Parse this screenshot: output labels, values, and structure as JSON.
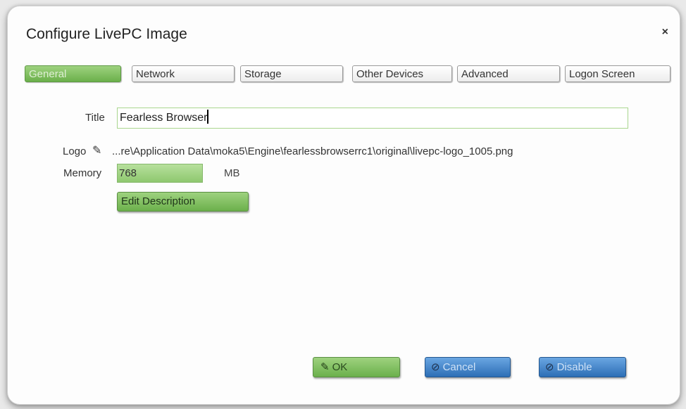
{
  "dialog": {
    "title": "Configure LivePC Image",
    "close_glyph": "×"
  },
  "tabs": [
    {
      "label": "General",
      "active": true
    },
    {
      "label": "Network",
      "active": false
    },
    {
      "label": "Storage",
      "active": false
    },
    {
      "label": "Other Devices",
      "active": false
    },
    {
      "label": "Advanced",
      "active": false
    },
    {
      "label": "Logon Screen",
      "active": false
    }
  ],
  "form": {
    "title_label": "Title",
    "title_value": "Fearless Browser",
    "logo_label": "Logo",
    "logo_icon": "pencil-icon",
    "logo_path": "...re\\Application Data\\moka5\\Engine\\fearlessbrowserrc1\\original\\livepc-logo_1005.png",
    "memory_label": "Memory",
    "memory_value": "768",
    "memory_unit": "MB",
    "edit_description_label": "Edit Description"
  },
  "buttons": {
    "ok_label": "OK",
    "cancel_label": "Cancel",
    "disable_label": "Disable"
  },
  "colors": {
    "accent_green": "#6bb04b",
    "accent_blue": "#2d6fb6"
  }
}
